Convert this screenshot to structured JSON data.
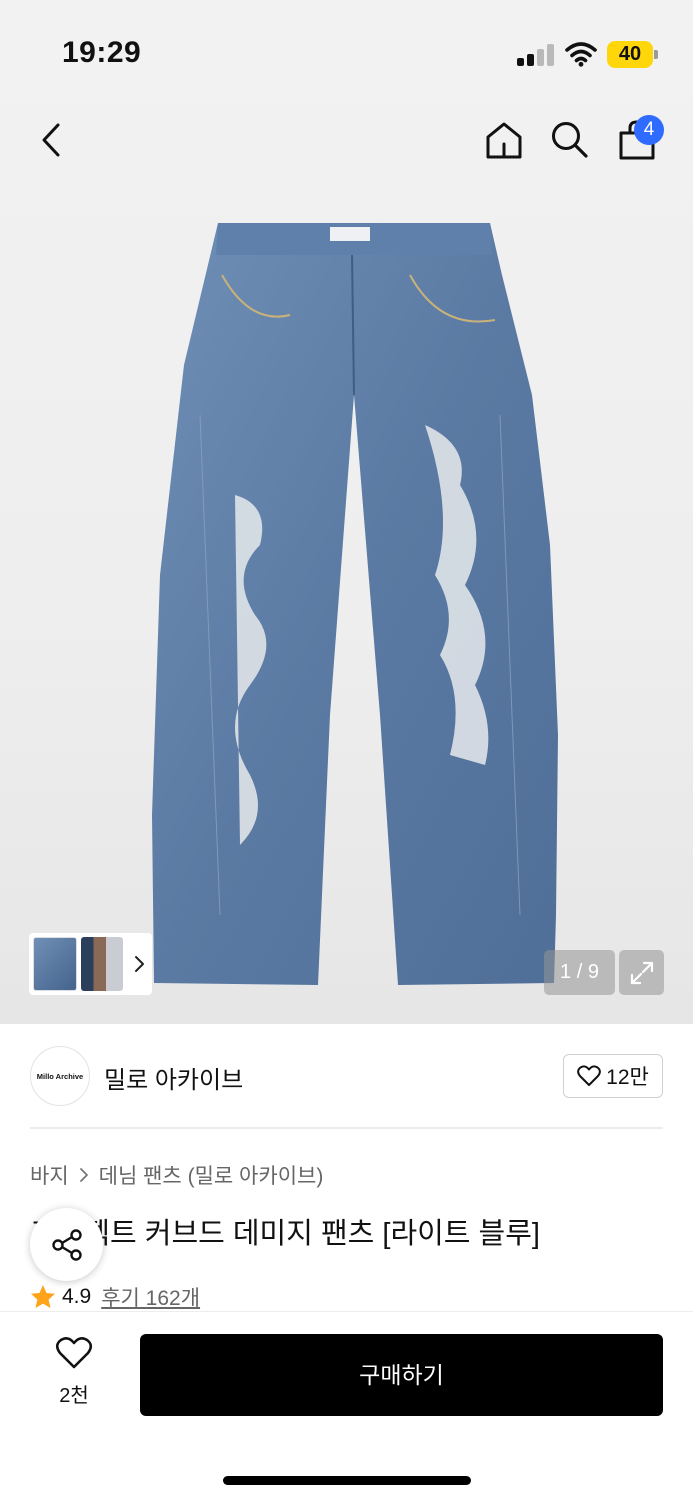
{
  "status_bar": {
    "time": "19:29",
    "battery": "40",
    "battery_color": "#ffd60a"
  },
  "nav": {
    "back_icon": "chevron-left-icon",
    "home_icon": "home-icon",
    "search_icon": "search-icon",
    "cart_icon": "shopping-bag-icon",
    "cart_badge": "4",
    "badge_color": "#2f6bff"
  },
  "gallery": {
    "counter": "1 / 9",
    "expand_icon": "expand-icon",
    "thumb_next_icon": "chevron-right-icon"
  },
  "brand": {
    "logo_text": "Millo Archive",
    "name": "밀로 아카이브",
    "like_count": "12만"
  },
  "breadcrumb": {
    "category": "바지",
    "subcategory": "데님 팬츠 (밀로 아카이브)"
  },
  "product": {
    "title": "프로젝트 커브드 데미지 팬츠 [라이트 블루]",
    "rating": "4.9",
    "reviews": "후기 162개",
    "star_color": "#ffa31a"
  },
  "bottom_bar": {
    "wish_count": "2천",
    "buy_label": "구매하기"
  }
}
